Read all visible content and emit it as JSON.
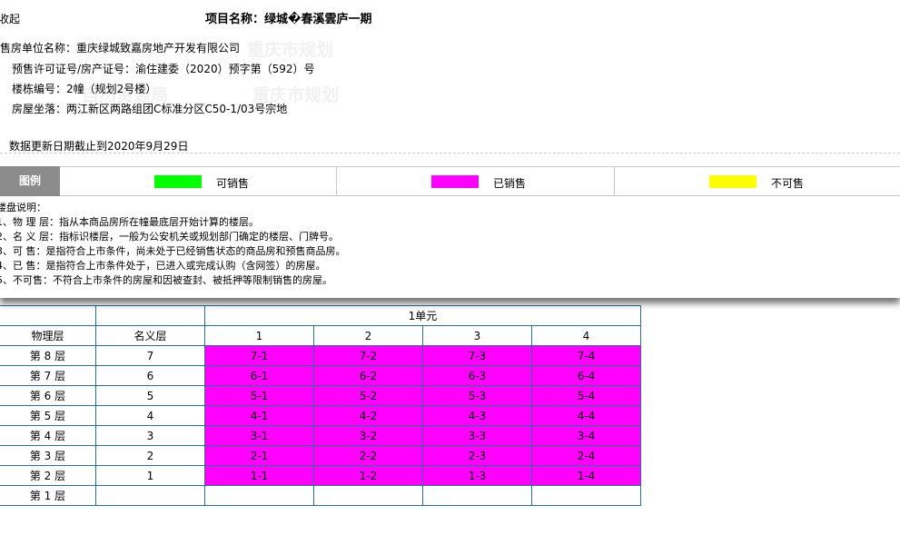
{
  "collapse_label": "收起",
  "project": {
    "title": "项目名称：绿城�春溪雲庐一期"
  },
  "info": {
    "seller": "售房单位名称：重庆绿城致嘉房地产开发有限公司",
    "permit": "预售许可证号/房产证号：渝住建委（2020）预字第（592）号",
    "building_no": "楼栋编号：2幢（规划2号楼）",
    "location": "房屋坐落：两江新区两路组团C标准分区C50-1/03号宗地",
    "update": "数据更新日期截止到2020年9月29日"
  },
  "watermarks": [
    "重庆市规划",
    "自然资源局",
    "重庆市规划"
  ],
  "legend": {
    "title": "图例",
    "items": [
      {
        "label": "可销售",
        "color": "#00ff00"
      },
      {
        "label": "已销售",
        "color": "#ff00ff"
      },
      {
        "label": "不可售",
        "color": "#ffff00"
      }
    ]
  },
  "explanation": {
    "title": "楼盘说明：",
    "lines": [
      "1、物 理 层：指从本商品房所在幢最底层开始计算的楼层。",
      "2、名 义 层：指标识楼层，一般为公安机关或规划部门确定的楼层、门牌号。",
      "3、可 售：是指符合上市条件，尚未处于已经销售状态的商品房和预售商品房。",
      "4、已 售：是指符合上市条件处于，已进入或完成认购（含网签）的房屋。",
      "5、不可售：不符合上市条件的房屋和因被查封、被抵押等限制销售的房屋。"
    ]
  },
  "table": {
    "unit_header": "1单元",
    "col_physical": "物理层",
    "col_nominal": "名义层",
    "room_cols": [
      "1",
      "2",
      "3",
      "4"
    ],
    "sold_color": "#ff00ff",
    "rows": [
      {
        "physical": "第 8 层",
        "nominal": "7",
        "rooms": [
          "7-1",
          "7-2",
          "7-3",
          "7-4"
        ],
        "status": "sold"
      },
      {
        "physical": "第 7 层",
        "nominal": "6",
        "rooms": [
          "6-1",
          "6-2",
          "6-3",
          "6-4"
        ],
        "status": "sold"
      },
      {
        "physical": "第 6 层",
        "nominal": "5",
        "rooms": [
          "5-1",
          "5-2",
          "5-3",
          "5-4"
        ],
        "status": "sold"
      },
      {
        "physical": "第 5 层",
        "nominal": "4",
        "rooms": [
          "4-1",
          "4-2",
          "4-3",
          "4-4"
        ],
        "status": "sold"
      },
      {
        "physical": "第 4 层",
        "nominal": "3",
        "rooms": [
          "3-1",
          "3-2",
          "3-3",
          "3-4"
        ],
        "status": "sold"
      },
      {
        "physical": "第 3 层",
        "nominal": "2",
        "rooms": [
          "2-1",
          "2-2",
          "2-3",
          "2-4"
        ],
        "status": "sold"
      },
      {
        "physical": "第 2 层",
        "nominal": "1",
        "rooms": [
          "1-1",
          "1-2",
          "1-3",
          "1-4"
        ],
        "status": "sold"
      },
      {
        "physical": "第 1 层",
        "nominal": "",
        "rooms": [
          "",
          "",
          "",
          ""
        ],
        "status": "empty"
      }
    ]
  }
}
